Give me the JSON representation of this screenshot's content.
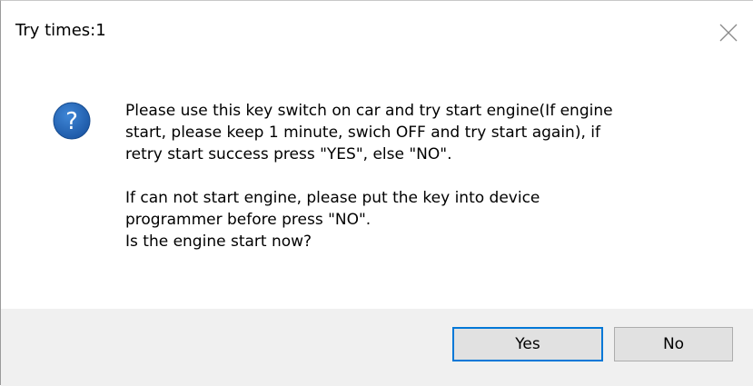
{
  "window": {
    "title": "Try times:1"
  },
  "icons": {
    "question": "question-icon",
    "close": "close-icon"
  },
  "message": {
    "para1_line1": "Please use this key switch on car and try start engine(If engine",
    "para1_line2": "start, please keep 1 minute, swich OFF and try start again), if",
    "para1_line3": "retry start success press \"YES\", else \"NO\".",
    "para2_line1": "If can not start engine, please put the key into device",
    "para2_line2": "programmer before press \"NO\".",
    "para2_line3": "Is the engine start now?"
  },
  "buttons": {
    "yes_label": "Yes",
    "no_label": "No"
  },
  "colors": {
    "accent": "#0078d7",
    "icon_blue": "#1e5aa8",
    "footer_bg": "#f0f0f0",
    "button_bg": "#e1e1e1"
  }
}
